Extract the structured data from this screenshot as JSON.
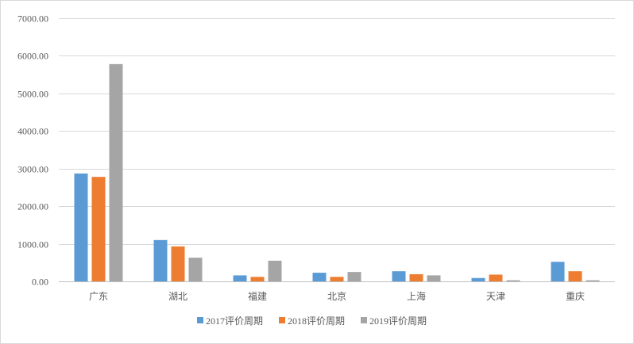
{
  "chart_data": {
    "type": "bar",
    "title": "",
    "xlabel": "",
    "ylabel": "",
    "categories": [
      "广东",
      "湖北",
      "福建",
      "北京",
      "上海",
      "天津",
      "重庆"
    ],
    "series": [
      {
        "name": "2017评价周期",
        "color": "#5b9bd5",
        "values": [
          2870,
          1100,
          160,
          230,
          270,
          90,
          520
        ]
      },
      {
        "name": "2018评价周期",
        "color": "#ed7d31",
        "values": [
          2780,
          930,
          120,
          120,
          190,
          180,
          270
        ]
      },
      {
        "name": "2019评价周期",
        "color": "#a5a5a5",
        "values": [
          5780,
          630,
          550,
          250,
          160,
          30,
          30
        ]
      }
    ],
    "ylim": [
      0,
      7000
    ],
    "yticks": [
      "0.00",
      "1000.00",
      "2000.00",
      "3000.00",
      "4000.00",
      "5000.00",
      "6000.00",
      "7000.00"
    ],
    "grid": true,
    "legend": "bottom"
  }
}
